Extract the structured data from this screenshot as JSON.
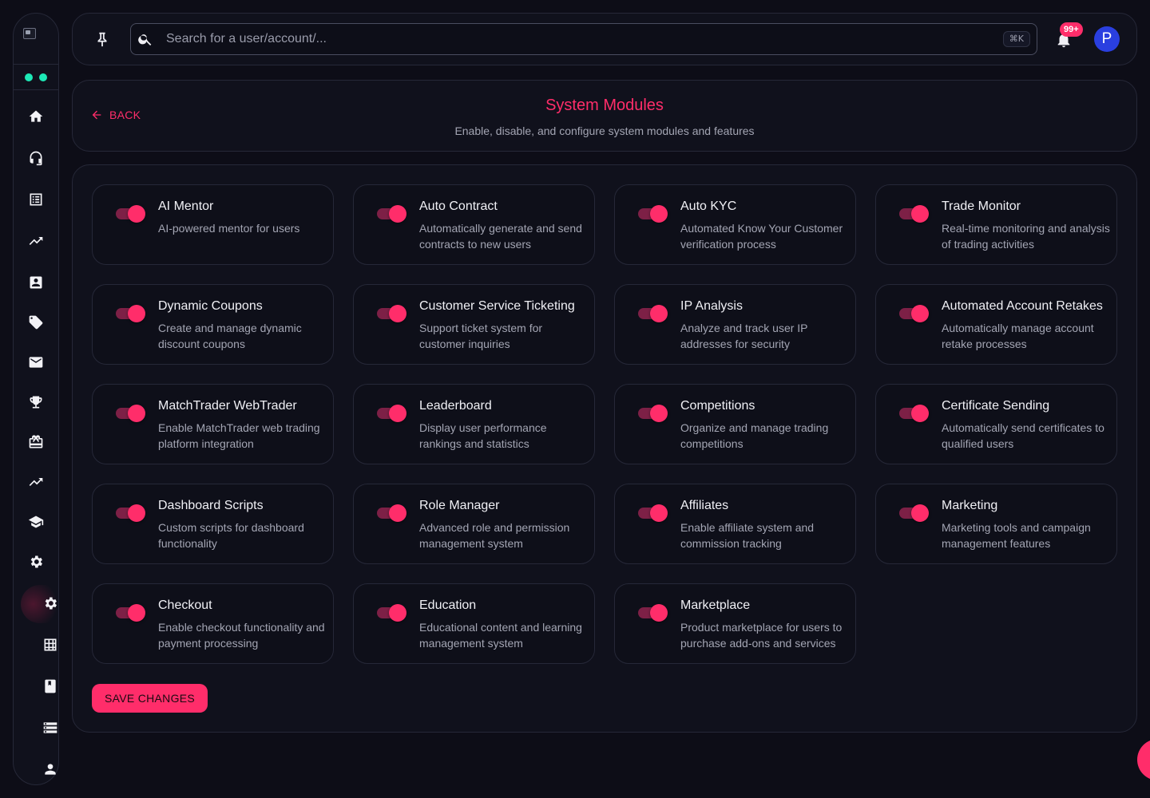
{
  "colors": {
    "accent": "#ff2d6a",
    "background": "#0d0d17",
    "card": "#10111c",
    "avatar": "#2a3fe0",
    "online_dot": "#1de9b6"
  },
  "sidebar": {
    "items": [
      {
        "icon": "home-icon"
      },
      {
        "icon": "headset-icon"
      },
      {
        "icon": "list-icon"
      },
      {
        "icon": "trending-up-icon"
      },
      {
        "icon": "contact-card-icon"
      },
      {
        "icon": "tag-icon"
      },
      {
        "icon": "mail-icon"
      },
      {
        "icon": "trophy-icon"
      },
      {
        "icon": "gift-card-icon"
      },
      {
        "icon": "chart-line-icon"
      },
      {
        "icon": "graduation-cap-icon"
      },
      {
        "icon": "gear-icon"
      },
      {
        "icon": "gear-icon",
        "active": true
      },
      {
        "icon": "grid-icon"
      },
      {
        "icon": "book-icon"
      },
      {
        "icon": "server-list-icon"
      },
      {
        "icon": "user-icon"
      }
    ]
  },
  "topbar": {
    "search_placeholder": "Search for a user/account/...",
    "shortcut": "⌘K",
    "notification_badge": "99+",
    "avatar_initial": "P"
  },
  "header": {
    "back_label": "BACK",
    "title": "System Modules",
    "subtitle": "Enable, disable, and configure system modules and features"
  },
  "modules": [
    {
      "title": "AI Mentor",
      "description": "AI-powered mentor for users",
      "enabled": true
    },
    {
      "title": "Auto Contract",
      "description": "Automatically generate and send contracts to new users",
      "enabled": true
    },
    {
      "title": "Auto KYC",
      "description": "Automated Know Your Customer verification process",
      "enabled": true
    },
    {
      "title": "Trade Monitor",
      "description": "Real-time monitoring and analysis of trading activities",
      "enabled": true
    },
    {
      "title": "Dynamic Coupons",
      "description": "Create and manage dynamic discount coupons",
      "enabled": true
    },
    {
      "title": "Customer Service Ticketing",
      "description": "Support ticket system for customer inquiries",
      "enabled": true
    },
    {
      "title": "IP Analysis",
      "description": "Analyze and track user IP addresses for security",
      "enabled": true
    },
    {
      "title": "Automated Account Retakes",
      "description": "Automatically manage account retake processes",
      "enabled": true
    },
    {
      "title": "MatchTrader WebTrader",
      "description": "Enable MatchTrader web trading platform integration",
      "enabled": true
    },
    {
      "title": "Leaderboard",
      "description": "Display user performance rankings and statistics",
      "enabled": true
    },
    {
      "title": "Competitions",
      "description": "Organize and manage trading competitions",
      "enabled": true
    },
    {
      "title": "Certificate Sending",
      "description": "Automatically send certificates to qualified users",
      "enabled": true
    },
    {
      "title": "Dashboard Scripts",
      "description": "Custom scripts for dashboard functionality",
      "enabled": true
    },
    {
      "title": "Role Manager",
      "description": "Advanced role and permission management system",
      "enabled": true
    },
    {
      "title": "Affiliates",
      "description": "Enable affiliate system and commission tracking",
      "enabled": true
    },
    {
      "title": "Marketing",
      "description": "Marketing tools and campaign management features",
      "enabled": true
    },
    {
      "title": "Checkout",
      "description": "Enable checkout functionality and payment processing",
      "enabled": true
    },
    {
      "title": "Education",
      "description": "Educational content and learning management system",
      "enabled": true
    },
    {
      "title": "Marketplace",
      "description": "Product marketplace for users to purchase add-ons and services",
      "enabled": true
    }
  ],
  "actions": {
    "save_label": "SAVE CHANGES"
  }
}
